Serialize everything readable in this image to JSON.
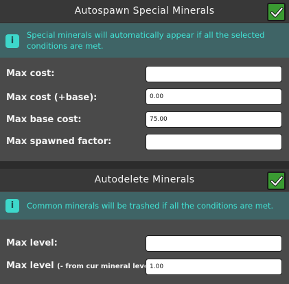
{
  "autospawn": {
    "title": "Autospawn Special Minerals",
    "enabled": true,
    "info_text": "Special minerals will automatically appear if all the selected conditions are met.",
    "fields": [
      {
        "label": "Max cost:",
        "value": ""
      },
      {
        "label": "Max cost (+base):",
        "value": "0.00"
      },
      {
        "label": "Max base cost:",
        "value": "75.00"
      },
      {
        "label": "Max spawned factor:",
        "value": ""
      }
    ]
  },
  "autodelete": {
    "title": "Autodelete Minerals",
    "enabled": true,
    "info_text": "Common minerals will be trashed if all the conditions are met.",
    "fields": [
      {
        "label": "Max level:",
        "value": ""
      },
      {
        "label": "Max level",
        "label_suffix": "(- from cur mineral level):",
        "value": "1.00"
      }
    ]
  },
  "icons": {
    "checkbox": "checkmark-icon",
    "info": "info-icon"
  },
  "colors": {
    "check_green": "#3a9a32",
    "info_teal": "#41e4d6",
    "panel_bg": "#4a4a4a"
  }
}
